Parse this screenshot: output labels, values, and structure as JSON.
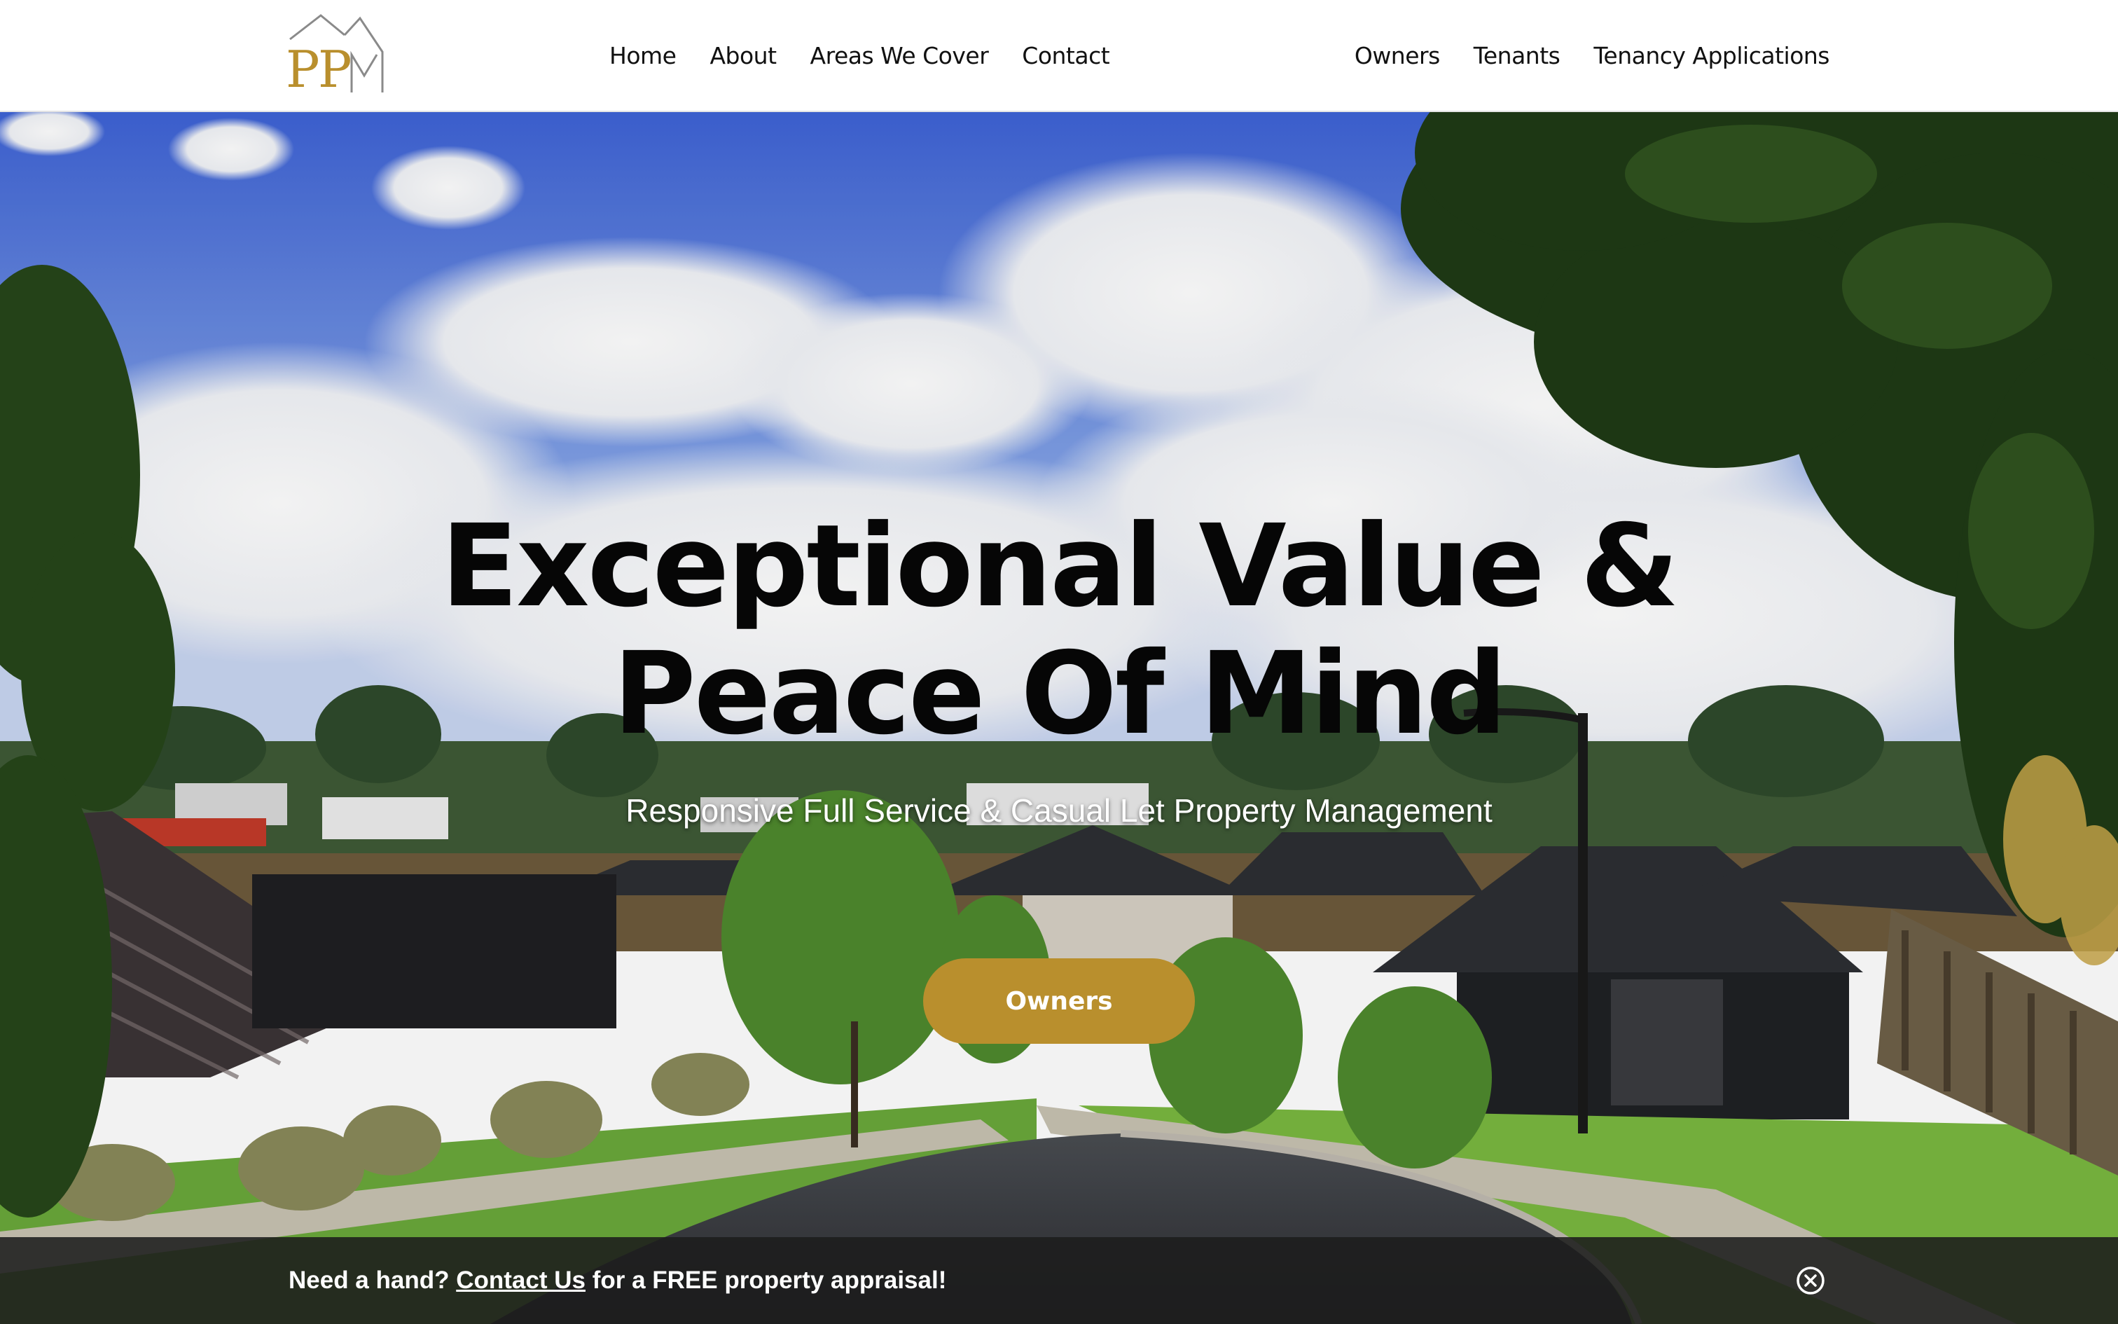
{
  "header": {
    "logo_letters": "PPM",
    "nav_left": [
      {
        "label": "Home"
      },
      {
        "label": "About"
      },
      {
        "label": "Areas We Cover"
      },
      {
        "label": "Contact"
      }
    ],
    "nav_right": [
      {
        "label": "Owners"
      },
      {
        "label": "Tenants"
      },
      {
        "label": "Tenancy Applications"
      }
    ]
  },
  "hero": {
    "title_line1": "Exceptional Value &",
    "title_line2": "Peace Of Mind",
    "subtitle": "Responsive Full Service & Casual Let Property Management",
    "cta_label": "Owners",
    "background": "suburban-street-photo"
  },
  "promo_bar": {
    "text_before": "Need a hand? ",
    "link_label": "Contact Us",
    "text_after": " for a FREE property appraisal!",
    "close_icon": "close-circle-icon"
  },
  "colors": {
    "brand_gold": "#b98f2d",
    "logo_gray": "#8a8a8a",
    "title": "#060606",
    "promo_bar_bg": "#1c1c1c"
  }
}
